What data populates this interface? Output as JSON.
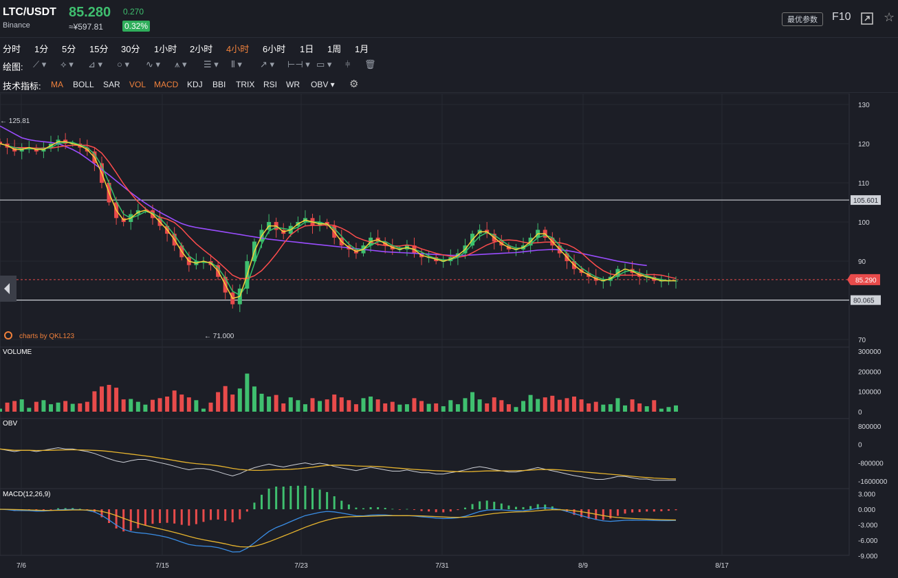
{
  "header": {
    "pair": "LTC/USDT",
    "exchange": "Binance",
    "price": "85.280",
    "cny": "≈¥597.81",
    "change": "0.270",
    "change_pct": "0.32%",
    "optimal_params": "最优参数",
    "f10": "F10"
  },
  "periods": [
    "分时",
    "1分",
    "5分",
    "15分",
    "30分",
    "1小时",
    "2小时",
    "4小时",
    "6小时",
    "1日",
    "1周",
    "1月"
  ],
  "active_period": "4小时",
  "draw_label": "绘图:",
  "indicator_label": "技术指标:",
  "indicators": [
    "MA",
    "BOLL",
    "SAR",
    "VOL",
    "MACD",
    "KDJ",
    "BBI",
    "TRIX",
    "RSI",
    "WR",
    "OBV"
  ],
  "active_indicators": [
    "MA",
    "VOL",
    "MACD"
  ],
  "colors": {
    "up": "#3fbf6f",
    "down": "#e84b4b",
    "ma5": "#f5d33a",
    "ma10": "#33c46b",
    "ma20": "#ff4d4d",
    "ma60": "#9a4dff",
    "accent": "#f0813c"
  },
  "chart_data": {
    "type": "candlestick",
    "price_axis": {
      "ticks": [
        "130",
        "120",
        "110",
        "100",
        "90",
        "70"
      ],
      "ylim": [
        66,
        131
      ]
    },
    "x_ticks": [
      "7/6",
      "7/15",
      "7/23",
      "7/31",
      "8/9",
      "8/17"
    ],
    "annotations": {
      "high": "← 125.81",
      "low": "← 71.000",
      "hline_upper": "105.601",
      "hline_lower": "80.065",
      "current": "85.290"
    },
    "watermark": "charts by QKL123",
    "close": [
      120,
      119,
      118,
      119,
      119,
      118,
      119,
      120,
      121,
      120,
      120,
      119,
      118,
      115,
      110,
      105,
      101,
      100,
      102,
      103,
      103,
      101,
      99,
      97,
      94,
      91,
      89,
      90,
      90,
      89,
      86,
      82,
      79,
      83,
      90,
      95,
      98,
      100,
      98,
      97,
      99,
      100,
      101,
      99,
      100,
      99,
      96,
      94,
      93,
      92,
      94,
      96,
      95,
      94,
      93,
      93,
      94,
      92,
      91,
      91,
      90,
      90,
      91,
      92,
      94,
      97,
      98,
      97,
      95,
      94,
      93,
      93,
      94,
      96,
      98,
      96,
      94,
      92,
      90,
      88,
      87,
      86,
      85,
      85,
      86,
      88,
      88,
      87,
      86,
      86,
      85,
      85,
      85,
      85
    ],
    "ma60": [
      124.5,
      123.5,
      122.5,
      121.5,
      121,
      120.7,
      120.5,
      120.3,
      120,
      119.3,
      118.5,
      117.5,
      116.2,
      114.8,
      113.4,
      112,
      110.5,
      109,
      107.5,
      106.1,
      104.8,
      103.6,
      102.5,
      101.5,
      100.5,
      99.6,
      99,
      98.6,
      98.3,
      98,
      97.7,
      97.4,
      97.1,
      96.8,
      96.5,
      96.2,
      95.9,
      95.6,
      95.4,
      95.2,
      95,
      94.8,
      94.6,
      94.4,
      94.2,
      94,
      93.8,
      93.6,
      93.4,
      93.2,
      93,
      92.8,
      92.6,
      92.4,
      92.3,
      92.2,
      92.1,
      92,
      91.9,
      91.8,
      91.7,
      91.6,
      91.5,
      91.5,
      91.5,
      91.6,
      91.7,
      91.8,
      91.9,
      92,
      92.1,
      92.2,
      92.4,
      92.6,
      92.8,
      92.9,
      93,
      92.9,
      92.7,
      92.4,
      92,
      91.6,
      91.2,
      90.8,
      90.4,
      90,
      89.7,
      89.4,
      89.1,
      88.9
    ],
    "volume_axis": {
      "ticks": [
        "300000",
        "200000",
        "100000",
        "0"
      ],
      "ylim": [
        0,
        300000
      ]
    },
    "volume_title": "VOLUME",
    "obv_axis": {
      "ticks": [
        "800000",
        "0",
        "-800000",
        "-1600000"
      ],
      "ylim": [
        -1700000,
        800000
      ]
    },
    "obv_title": "OBV",
    "macd_axis": {
      "ticks": [
        "3.000",
        "0.000",
        "-3.000",
        "-6.000",
        "-9.000"
      ],
      "ylim": [
        -9,
        3.5
      ]
    },
    "macd_title": "MACD(12,26,9)"
  }
}
